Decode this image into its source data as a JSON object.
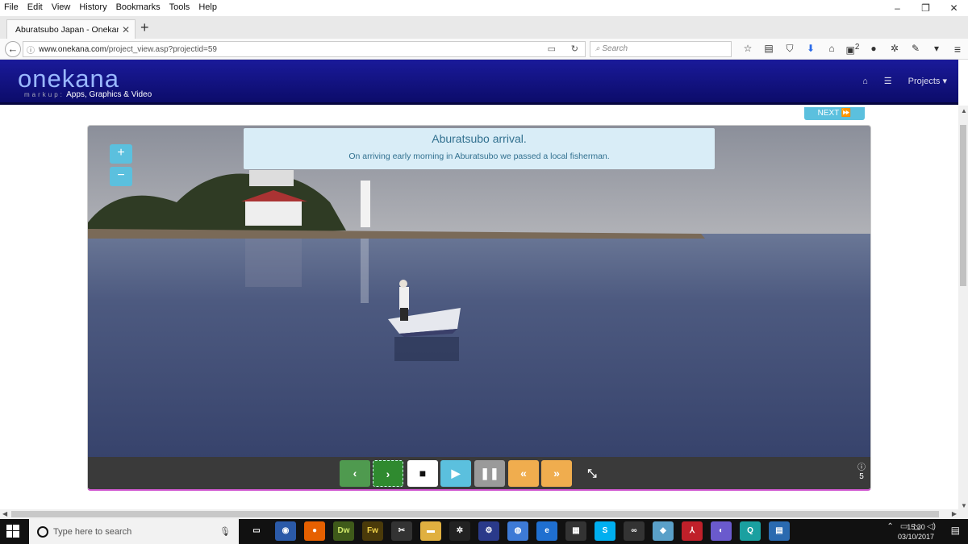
{
  "browser": {
    "menu": [
      "File",
      "Edit",
      "View",
      "History",
      "Bookmarks",
      "Tools",
      "Help"
    ],
    "window_controls": {
      "minimize": "–",
      "restore": "❐",
      "close": "✕"
    },
    "tab_title": "Aburatsubo Japan - Onekana Pr…",
    "tab_close": "✕",
    "new_tab": "+",
    "url_host": "www.onekana.com",
    "url_path": "/project_view.asp?projectid=59",
    "search_placeholder": "Search",
    "download_badge": "2"
  },
  "site": {
    "logo": "onekana",
    "logo_sub_prefix": "markup:",
    "logo_sub": "Apps, Graphics & Video",
    "nav_projects": "Projects ▾",
    "next_label": "NEXT ⏩"
  },
  "viewer": {
    "caption_title": "Aburatsubo arrival.",
    "caption_text": "On arriving early morning in Aburatsubo we passed a local fisherman.",
    "zoom_in": "+",
    "zoom_out": "−",
    "image_count": "5"
  },
  "taskbar": {
    "search_placeholder": "Type here to search",
    "time": "15:30",
    "date": "03/10/2017"
  },
  "colors": {
    "header": "#1a1a9a",
    "info": "#5bc0de",
    "success": "#4f9a4f",
    "warning": "#f0ad4e",
    "caption_bg": "#d9edf7"
  }
}
